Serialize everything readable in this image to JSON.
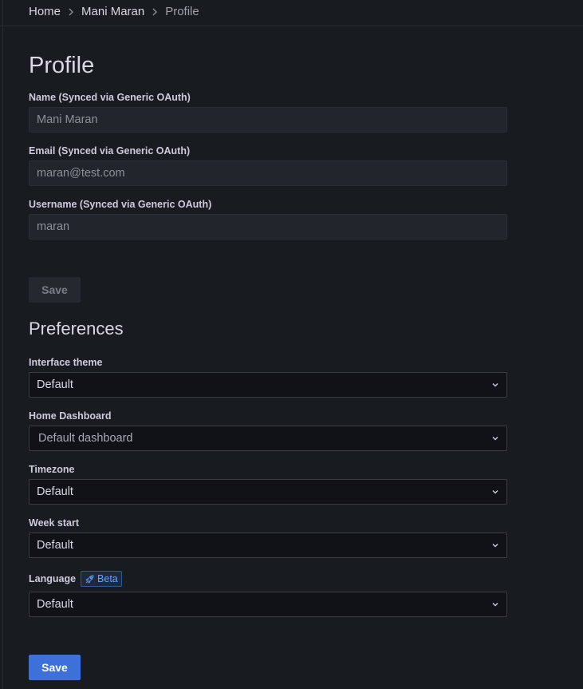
{
  "breadcrumb": {
    "items": [
      "Home",
      "Mani Maran",
      "Profile"
    ]
  },
  "profile": {
    "title": "Profile",
    "name_label": "Name (Synced via Generic OAuth)",
    "name_value": "Mani Maran",
    "email_label": "Email (Synced via Generic OAuth)",
    "email_value": "maran@test.com",
    "username_label": "Username (Synced via Generic OAuth)",
    "username_value": "maran",
    "save_label": "Save"
  },
  "preferences": {
    "title": "Preferences",
    "theme_label": "Interface theme",
    "theme_value": "Default",
    "home_dashboard_label": "Home Dashboard",
    "home_dashboard_value": "Default dashboard",
    "timezone_label": "Timezone",
    "timezone_value": "Default",
    "week_start_label": "Week start",
    "week_start_value": "Default",
    "language_label": "Language",
    "language_badge": "Beta",
    "language_value": "Default",
    "save_label": "Save"
  },
  "colors": {
    "background": "#181b1f",
    "primary": "#3d71d9",
    "beta": "#6e9fff"
  },
  "icons": [
    "chevron-right-icon",
    "chevron-down-icon",
    "rocket-icon"
  ]
}
